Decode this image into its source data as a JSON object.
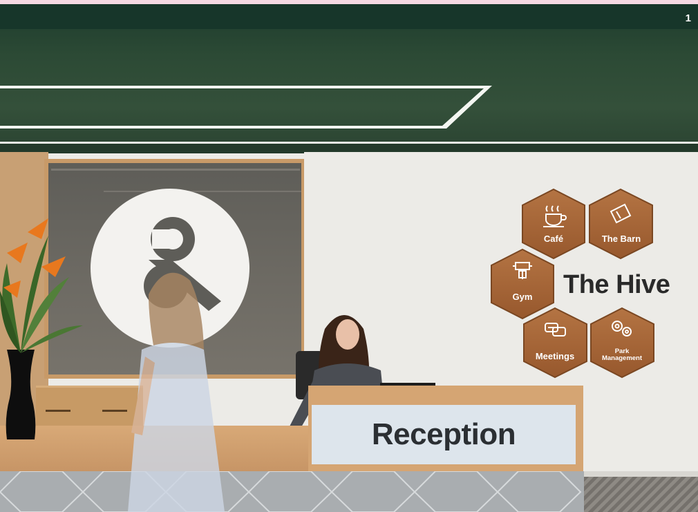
{
  "page_number": "1",
  "reception_sign": "Reception",
  "wayfinding": {
    "title": "The Hive",
    "hexagons": [
      {
        "label": "Café",
        "icon": "coffee-cup-icon"
      },
      {
        "label": "The Barn",
        "icon": "barn-ticket-icon"
      },
      {
        "label": "Gym",
        "icon": "dumbbell-icon"
      },
      {
        "label": "Meetings",
        "icon": "speech-bubbles-icon"
      },
      {
        "label": "Park\nManagement",
        "icon": "gears-icon"
      }
    ]
  },
  "colors": {
    "ceiling": "#2c4a35",
    "wood": "#a3673a",
    "wall": "#ecebe7",
    "sign_text": "#2b2f33"
  }
}
